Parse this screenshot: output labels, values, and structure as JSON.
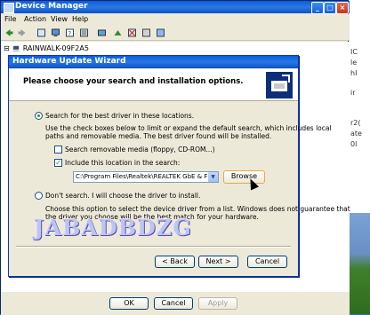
{
  "desktop": {
    "fragments": [
      "IC",
      "le",
      "hI",
      "ir",
      "r2(",
      "ate",
      "0l"
    ]
  },
  "device_manager": {
    "title": "Device Manager",
    "menu": [
      "File",
      "Action",
      "View",
      "Help"
    ],
    "computer_node": "RAINWALK-09F2A5",
    "bottom_buttons": {
      "ok": "OK",
      "cancel": "Cancel",
      "apply": "Apply"
    }
  },
  "wizard": {
    "title": "Hardware Update Wizard",
    "heading": "Please choose your search and installation options.",
    "option_search": "Search for the best driver in these locations.",
    "option_search_desc1": "Use the check boxes below to limit or expand the default search, which includes local",
    "option_search_desc2": "paths and removable media. The best driver found will be installed.",
    "chk_removable": "Search removable media (floppy, CD-ROM...)",
    "chk_include": "Include this location in the search:",
    "location_value": "C:\\Program Files\\Realtek\\REALTEK GbE & FE Ethe",
    "browse": "Browse",
    "option_dont": "Don't search. I will choose the driver to install.",
    "option_dont_desc1": "Choose this option to select the device driver from a list.  Windows does not guarantee that",
    "option_dont_desc2": "the driver you choose will be the best match for your hardware.",
    "back": "< Back",
    "next": "Next >",
    "cancel": "Cancel",
    "search_selected": true,
    "removable_checked": false,
    "include_checked": true
  },
  "watermark": "JABADBDZG",
  "colors": {
    "titlebar": "#0a5fd8",
    "face": "#ece9d8"
  }
}
